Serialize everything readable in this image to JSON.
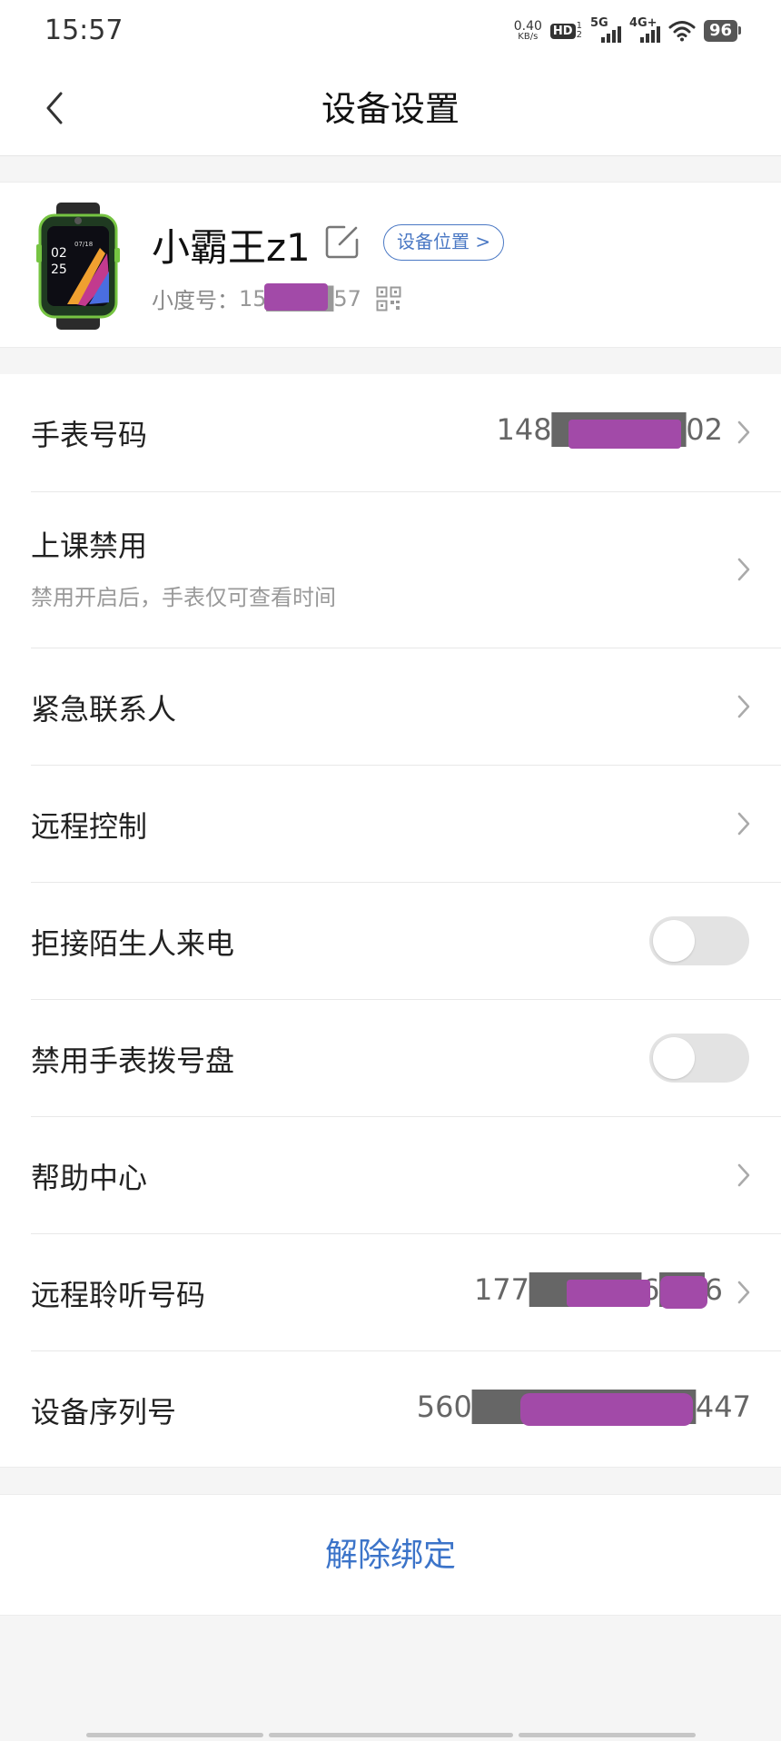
{
  "status_bar": {
    "time": "15:57",
    "net_speed_value": "0.40",
    "net_speed_unit": "KB/s",
    "hd_label": "HD",
    "hd_sub_top": "1",
    "hd_sub_bottom": "2",
    "sim1_label": "5G",
    "sim2_label": "4G+",
    "battery_level": "96"
  },
  "header": {
    "title": "设备设置"
  },
  "device": {
    "name": "小霸王z1",
    "location_button": "设备位置 >",
    "id_label": "小度号：",
    "id_value": "15████57",
    "watch_time_hour": "02",
    "watch_time_min": "25",
    "watch_date": "07/18"
  },
  "settings": {
    "watch_number": {
      "label": "手表号码",
      "value": "148██████02"
    },
    "class_mode": {
      "label": "上课禁用",
      "subtitle": "禁用开启后，手表仅可查看时间"
    },
    "emergency_contacts": {
      "label": "紧急联系人"
    },
    "remote_control": {
      "label": "远程控制"
    },
    "reject_strangers": {
      "label": "拒接陌生人来电",
      "enabled": false
    },
    "disable_dialpad": {
      "label": "禁用手表拨号盘",
      "enabled": false
    },
    "help_center": {
      "label": "帮助中心"
    },
    "remote_listen_number": {
      "label": "远程聆听号码",
      "value": "177█████6██6"
    },
    "serial_number": {
      "label": "设备序列号",
      "value": "560██████████447"
    }
  },
  "unbind": {
    "label": "解除绑定"
  },
  "colors": {
    "accent_blue": "#3c74c9",
    "redaction_purple": "#a24aa8",
    "toggle_off": "#e3e3e3"
  }
}
